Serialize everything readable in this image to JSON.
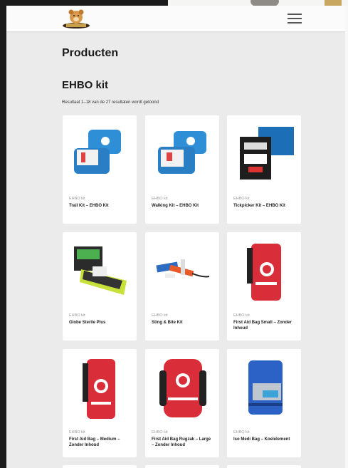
{
  "header": {
    "logo_icon": "teddy-bear-logo-icon",
    "menu_icon": "hamburger-menu-icon"
  },
  "page": {
    "title": "Producten",
    "category": "EHBO kit",
    "result_count": "Resultaat 1–18 van de 27 resultaten wordt getoond"
  },
  "products": [
    {
      "category": "EHBO kit",
      "name": "Trail Kit – EHBO Kit",
      "image": "blue-kit-open",
      "color": "#2f8fd6"
    },
    {
      "category": "EHBO kit",
      "name": "Walking Kit – EHBO Kit",
      "image": "blue-kit-open",
      "color": "#2f8fd6"
    },
    {
      "category": "EHBO kit",
      "name": "Tickpicker Kit – EHBO Kit",
      "image": "black-card-kit",
      "color": "#1e1e1e"
    },
    {
      "category": "EHBO kit",
      "name": "Globe Sterile Plus",
      "image": "green-pouch",
      "color": "#c8e03a"
    },
    {
      "category": "EHBO kit",
      "name": "Sting & Bite Kit",
      "image": "tools-set",
      "color": "#e85a2a"
    },
    {
      "category": "EHBO kit",
      "name": "First Aid Bag Small – Zonder Inhoud",
      "image": "red-bag",
      "color": "#d92e3a"
    },
    {
      "category": "EHBO kit",
      "name": "First Aid Bag – Medium – Zonder Inhoud",
      "image": "red-bag",
      "color": "#d92e3a"
    },
    {
      "category": "EHBO kit",
      "name": "First Aid Bag Rugzak – Large – Zonder Inhoud",
      "image": "red-backpack",
      "color": "#d92e3a"
    },
    {
      "category": "EHBO kit",
      "name": "Iso Medi Bag – Koelelement",
      "image": "blue-cooler-bag",
      "color": "#2c62c6"
    }
  ]
}
